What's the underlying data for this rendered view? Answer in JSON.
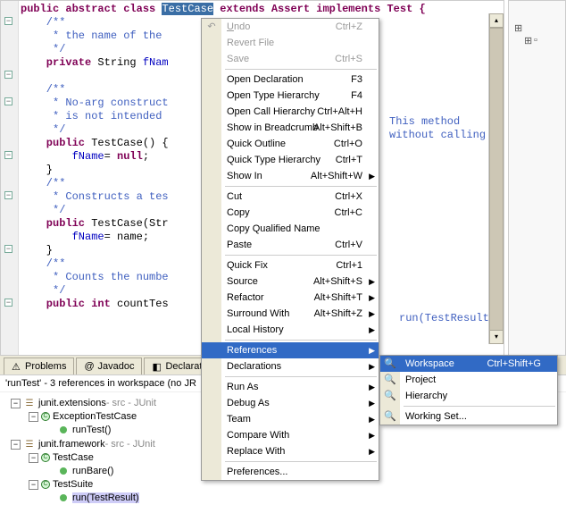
{
  "code": {
    "line1_pre": "public abstract class ",
    "line1_sel": "TestCase",
    "line1_post": " extends Assert implements Test {",
    "l2": "    /**",
    "l3": "     * the name of the",
    "l4": "     */",
    "l5a": "    private",
    "l5b": " String ",
    "l5c": "fNam",
    "l7": "    /**",
    "l8": "     * No-arg construct",
    "l9": "     * is not intended",
    "l10": "     */",
    "l11a": "    public",
    "l11b": " TestCase() {",
    "l12a": "        ",
    "l12b": "fName",
    "l12c": "= ",
    "l12d": "null",
    "l12e": ";",
    "l13": "    }",
    "l14": "    /**",
    "l15": "     * Constructs a tes",
    "l16": "     */",
    "l17a": "    public",
    "l17b": " TestCase(Str",
    "l18a": "        ",
    "l18b": "fName",
    "l18c": "= name;",
    "l19": "    }",
    "l20": "    /**",
    "l21": "     * Counts the numbe",
    "l22": "     */",
    "l23a": "    public int",
    "l23b": " countTes",
    "annot1": "This method",
    "annot2": "without calling",
    "annot3": "run(TestResult"
  },
  "menu": {
    "undo": "Undo",
    "undo_k": "Ctrl+Z",
    "revert": "Revert File",
    "save": "Save",
    "save_k": "Ctrl+S",
    "open_decl": "Open Declaration",
    "open_decl_k": "F3",
    "open_type_h": "Open Type Hierarchy",
    "open_type_h_k": "F4",
    "open_call_h": "Open Call Hierarchy",
    "open_call_h_k": "Ctrl+Alt+H",
    "breadcrumb": "Show in Breadcrumb",
    "breadcrumb_k": "Alt+Shift+B",
    "quick_outline": "Quick Outline",
    "quick_outline_k": "Ctrl+O",
    "quick_type_h": "Quick Type Hierarchy",
    "quick_type_h_k": "Ctrl+T",
    "show_in": "Show In",
    "show_in_k": "Alt+Shift+W",
    "cut": "Cut",
    "cut_k": "Ctrl+X",
    "copy": "Copy",
    "copy_k": "Ctrl+C",
    "copy_qn": "Copy Qualified Name",
    "paste": "Paste",
    "paste_k": "Ctrl+V",
    "quick_fix": "Quick Fix",
    "quick_fix_k": "Ctrl+1",
    "source": "Source",
    "source_k": "Alt+Shift+S",
    "refactor": "Refactor",
    "refactor_k": "Alt+Shift+T",
    "surround": "Surround With",
    "surround_k": "Alt+Shift+Z",
    "local_hist": "Local History",
    "references": "References",
    "declarations": "Declarations",
    "run_as": "Run As",
    "debug_as": "Debug As",
    "team": "Team",
    "compare": "Compare With",
    "replace": "Replace With",
    "prefs": "Preferences..."
  },
  "submenu": {
    "workspace": "Workspace",
    "workspace_k": "Ctrl+Shift+G",
    "project": "Project",
    "hierarchy": "Hierarchy",
    "working_set": "Working Set..."
  },
  "tabs": {
    "problems": "Problems",
    "javadoc": "Javadoc",
    "declaration": "Declaration"
  },
  "search": {
    "header": "'runTest' - 3 references in workspace (no JR",
    "pkg1": "junit.extensions",
    "pkg1_decor": " - src - JUnit",
    "cls1": "ExceptionTestCase",
    "meth1": "runTest()",
    "pkg2": "junit.framework",
    "pkg2_decor": " - src - JUnit",
    "cls2": "TestCase",
    "meth2": "runBare()",
    "cls3": "TestSuite",
    "meth3": "run(TestResult)"
  }
}
